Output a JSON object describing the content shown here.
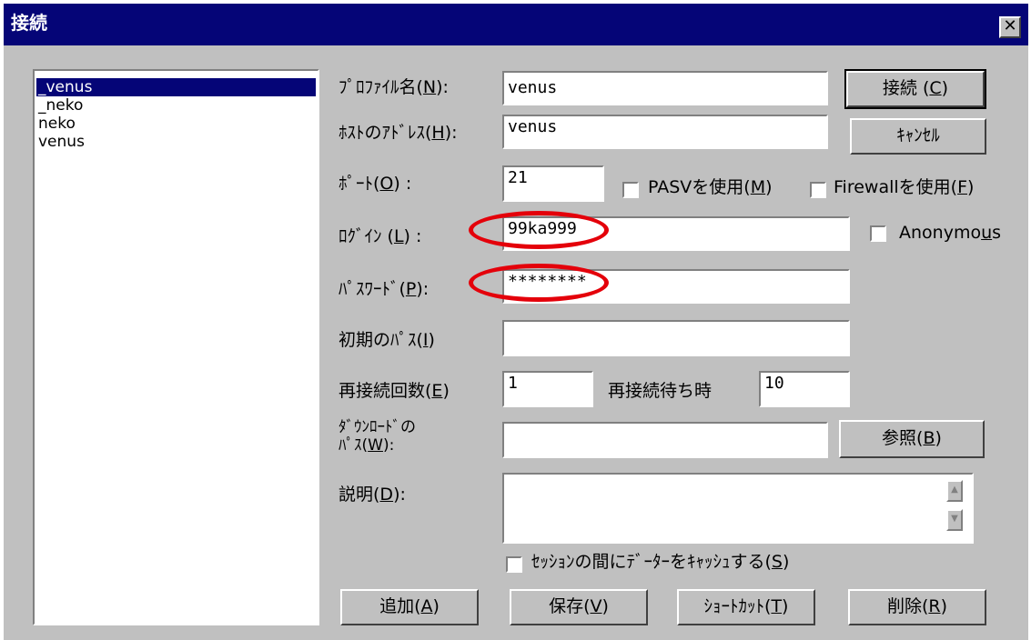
{
  "window": {
    "title": "接続",
    "close_glyph": "✕"
  },
  "profiles": [
    "_venus",
    "_neko",
    "neko",
    "venus"
  ],
  "form": {
    "profile_label": "ﾌﾟﾛﾌｧｲﾙ名(",
    "profile_key": "N",
    "profile_suffix": "):",
    "profile_value": " venus",
    "host_label": "ﾎｽﾄのｱﾄﾞﾚｽ(",
    "host_key": "H",
    "host_suffix": "):",
    "host_value": "venus",
    "port_label": "ﾎﾟｰﾄ(",
    "port_key": "O",
    "port_suffix": ") :",
    "port_value": "21",
    "pasv_label": "PASVを使用(",
    "pasv_key": "M",
    "pasv_suffix": ")",
    "firewall_label": "Firewallを使用(",
    "firewall_key": "F",
    "firewall_suffix": ")",
    "login_label": "ﾛｸﾞｲﾝ (",
    "login_key": "L",
    "login_suffix": ") :",
    "login_value": "99ka999",
    "anonymous_label": "Anonymo",
    "anonymous_key": "u",
    "anonymous_suffix": "s",
    "password_label": "ﾊﾟｽﾜｰﾄﾞ(",
    "password_key": "P",
    "password_suffix": "):",
    "password_value": "********",
    "initpath_label": "初期のﾊﾟｽ(",
    "initpath_key": "I",
    "initpath_suffix": ")",
    "initpath_value": "",
    "retry_label": "再接続回数(",
    "retry_key": "E",
    "retry_suffix": ")",
    "retry_value": "1",
    "wait_label": "再接続待ち時",
    "wait_value": "10",
    "download_label_1": "ﾀﾞｳﾝﾛｰﾄﾞの",
    "download_label_2": "ﾊﾟｽ(",
    "download_key": "W",
    "download_suffix": "):",
    "download_value": "",
    "desc_label": "説明(",
    "desc_key": "D",
    "desc_suffix": "):",
    "desc_value": "",
    "cache_label": "ｾｯｼｮﾝの間にﾃﾞｰﾀｰをｷｬｯｼｭする(",
    "cache_key": "S",
    "cache_suffix": ")"
  },
  "buttons": {
    "connect": "接続 (",
    "connect_key": "C",
    "connect_suffix": ")",
    "cancel": "ｷｬﾝｾﾙ",
    "browse": "参照(",
    "browse_key": "B",
    "browse_suffix": ")",
    "add": "追加(",
    "add_key": "A",
    "add_suffix": ")",
    "save": "保存(",
    "save_key": "V",
    "save_suffix": ")",
    "shortcut": "ｼｮｰﾄｶｯﾄ(",
    "shortcut_key": "T",
    "shortcut_suffix": ")",
    "delete": "削除(",
    "delete_key": "R",
    "delete_suffix": ")"
  },
  "colors": {
    "title_bar": "#050577",
    "dialog_bg": "#c0c0c0",
    "highlight_ring": "#e4000a"
  }
}
